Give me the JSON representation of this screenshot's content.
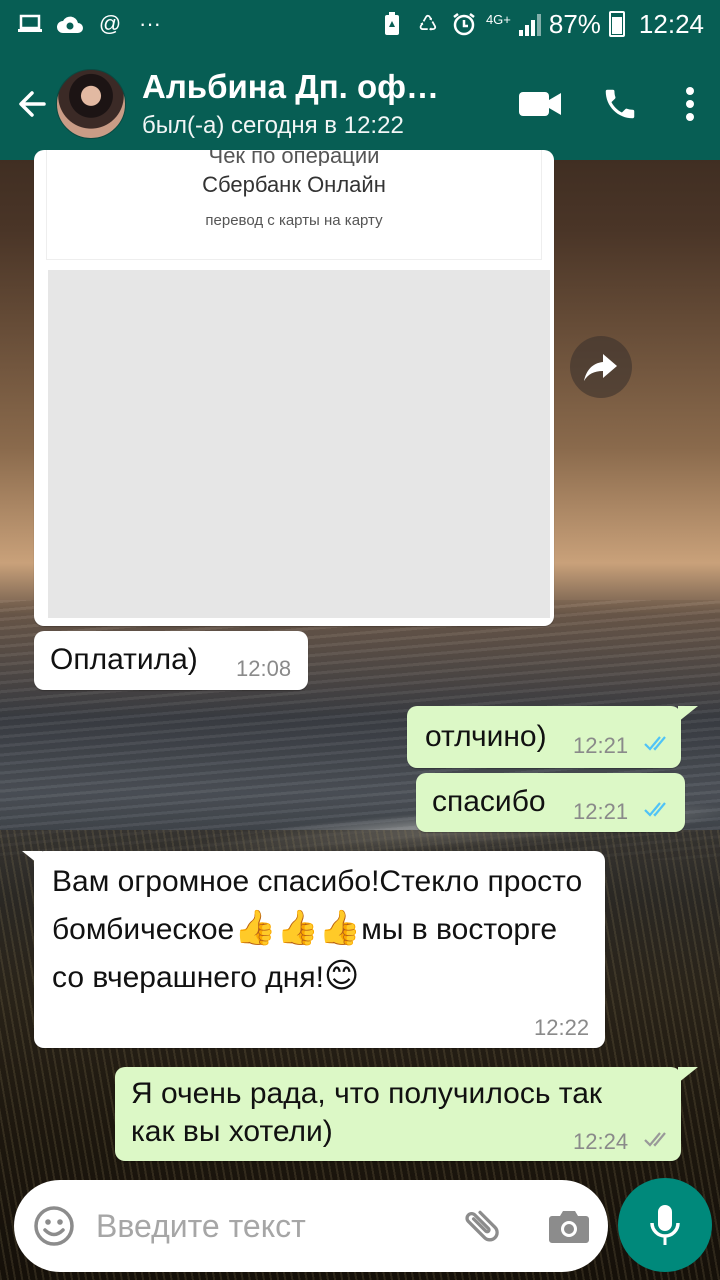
{
  "status_bar": {
    "network": "4G+",
    "battery_percent": "87%",
    "time": "12:24"
  },
  "header": {
    "contact_name": "Альбина Дп. оф…",
    "last_seen": "был(-а) сегодня в 12:22"
  },
  "receipt": {
    "title_line1": "Чек по операции",
    "title_line2": "Сбербанк Онлайн",
    "subtitle": "перевод с карты на карту"
  },
  "messages": [
    {
      "direction": "in",
      "text": "Оплатила)",
      "time": "12:08"
    },
    {
      "direction": "out",
      "text": "отлчино)",
      "time": "12:21",
      "status": "read"
    },
    {
      "direction": "out",
      "text": "спасибо",
      "time": "12:21",
      "status": "read"
    },
    {
      "direction": "in",
      "text_parts": [
        "Вам огромное спасибо!Стекло просто бомбическое",
        "мы в восторге со вчерашнего дня!"
      ],
      "emoji": "👍👍👍",
      "emoji_end": "😊",
      "time": "12:22"
    },
    {
      "direction": "out",
      "text": "Я очень рада, что получилось так как вы хотели)",
      "time": "12:24",
      "status": "delivered"
    }
  ],
  "input": {
    "placeholder": "Введите текст"
  },
  "colors": {
    "header": "#075e54",
    "incoming_bubble": "#ffffff",
    "outgoing_bubble": "#dcf8c6",
    "read_ticks": "#4fc3f7",
    "mic_button": "#00897b"
  }
}
